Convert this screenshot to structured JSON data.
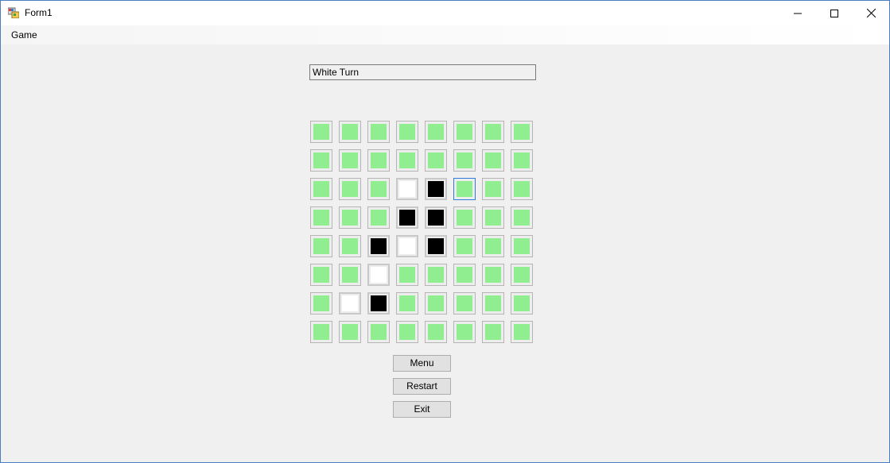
{
  "window": {
    "title": "Form1",
    "icon": "winforms-app-icon",
    "controls": {
      "minimize_icon": "minimize-icon",
      "maximize_icon": "maximize-icon",
      "close_icon": "close-icon"
    }
  },
  "menubar": {
    "items": [
      {
        "label": "Game"
      }
    ]
  },
  "status": {
    "text": "White Turn"
  },
  "board": {
    "rows": 8,
    "cols": 8,
    "colors": {
      "empty": "#90ee90",
      "white": "#ffffff",
      "black": "#000000"
    },
    "cells": [
      [
        "empty",
        "empty",
        "empty",
        "empty",
        "empty",
        "empty",
        "empty",
        "empty"
      ],
      [
        "empty",
        "empty",
        "empty",
        "empty",
        "empty",
        "empty",
        "empty",
        "empty"
      ],
      [
        "empty",
        "empty",
        "empty",
        "white",
        "black",
        "empty",
        "empty",
        "empty"
      ],
      [
        "empty",
        "empty",
        "empty",
        "black",
        "black",
        "empty",
        "empty",
        "empty"
      ],
      [
        "empty",
        "empty",
        "black",
        "white",
        "black",
        "empty",
        "empty",
        "empty"
      ],
      [
        "empty",
        "empty",
        "white",
        "empty",
        "empty",
        "empty",
        "empty",
        "empty"
      ],
      [
        "empty",
        "white",
        "black",
        "empty",
        "empty",
        "empty",
        "empty",
        "empty"
      ],
      [
        "empty",
        "empty",
        "empty",
        "empty",
        "empty",
        "empty",
        "empty",
        "empty"
      ]
    ],
    "focused": {
      "row": 2,
      "col": 5
    }
  },
  "buttons": {
    "menu_label": "Menu",
    "restart_label": "Restart",
    "exit_label": "Exit"
  }
}
